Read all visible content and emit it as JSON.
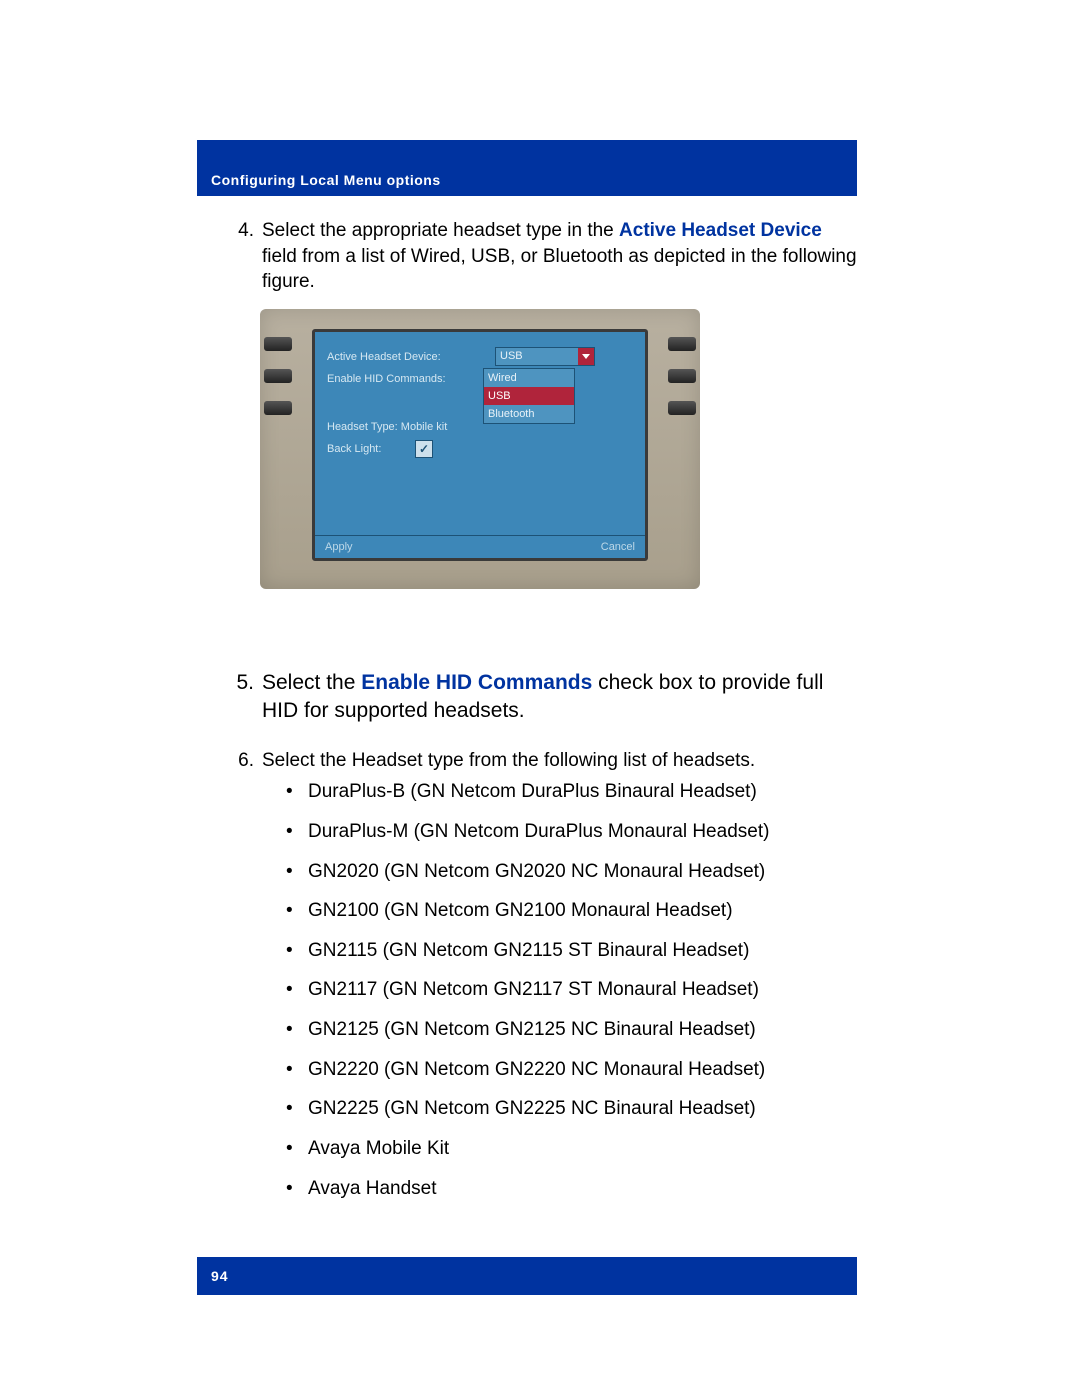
{
  "header": {
    "title": "Configuring Local Menu options"
  },
  "steps": {
    "s4": {
      "num": "4.",
      "text_before": "Select the appropriate headset type in the ",
      "bold": "Active Headset Device",
      "text_after": " field from a list of Wired, USB, or Bluetooth as depicted in the following figure."
    },
    "s5": {
      "num": "5.",
      "text_before": "Select the ",
      "bold": "Enable HID Commands",
      "text_after": " check box to provide full HID for supported headsets."
    },
    "s6": {
      "num": "6.",
      "text": "Select the Headset type from the following list of headsets."
    }
  },
  "figure": {
    "row1_label": "Active Headset Device:",
    "row1_value": "USB",
    "row2_label": "Enable HID Commands:",
    "row3_label": "Headset Type: Mobile kit",
    "row4_label": "Back Light:",
    "dd_opt1": "Wired",
    "dd_opt2": "USB",
    "dd_opt3": "Bluetooth",
    "btn_apply": "Apply",
    "btn_cancel": "Cancel"
  },
  "headsets": [
    "DuraPlus-B (GN Netcom DuraPlus Binaural Headset)",
    "DuraPlus-M (GN Netcom DuraPlus Monaural Headset)",
    "GN2020 (GN Netcom GN2020 NC Monaural Headset)",
    "GN2100 (GN Netcom GN2100 Monaural Headset)",
    "GN2115 (GN Netcom GN2115 ST Binaural Headset)",
    "GN2117 (GN Netcom GN2117 ST Monaural Headset)",
    "GN2125 (GN Netcom GN2125 NC Binaural Headset)",
    "GN2220 (GN Netcom GN2220 NC Monaural Headset)",
    "GN2225 (GN Netcom GN2225 NC Binaural Headset)",
    "Avaya Mobile Kit",
    "Avaya Handset"
  ],
  "footer": {
    "page_number": "94"
  }
}
